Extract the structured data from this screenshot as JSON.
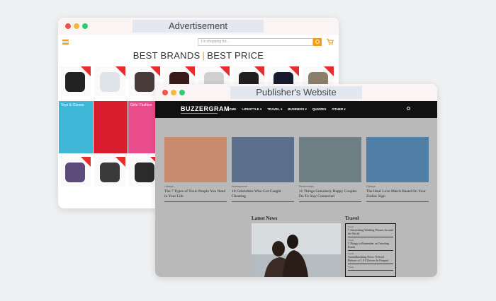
{
  "advertisement": {
    "window_title": "Advertisement",
    "search_placeholder": "I'm shopping for...",
    "headline_left": "BEST BRANDS",
    "headline_sep": "|",
    "headline_right": "BEST PRICE",
    "products": [
      {
        "color": "#222222"
      },
      {
        "color": "#dfe4ea"
      },
      {
        "color": "#4a3b3b"
      },
      {
        "color": "#3b1b1b"
      },
      {
        "color": "#d0d0d0"
      },
      {
        "color": "#1f1f1f"
      },
      {
        "color": "#1a1a2e"
      },
      {
        "color": "#8a7f6a"
      }
    ],
    "banners": [
      {
        "title": "Toys & Games",
        "color": "#3fb7d6"
      },
      {
        "title": "",
        "color": "#d81e2c"
      },
      {
        "title": "Girls' Fashion",
        "color": "#e94d8b"
      }
    ],
    "bottom_products": [
      {
        "color": "#5b4a7a"
      },
      {
        "color": "#3a3a3a"
      },
      {
        "color": "#2b2b2b"
      }
    ]
  },
  "publisher": {
    "window_title": "Publisher's Website",
    "logo": "BUZZERGRAM",
    "nav": [
      "HOME",
      "LIFESTYLE ▾",
      "TRAVEL ▾",
      "BUSINESS ▾",
      "QUIZZES",
      "OTHER ▾"
    ],
    "cards": [
      {
        "category": "Lifestyle",
        "title": "The 7 Types of Toxic People You Need in Your Life",
        "color": "#c98a6e"
      },
      {
        "category": "Entertainment",
        "title": "10 Celebrities Who Got Caught Cheating",
        "color": "#5b6f8c"
      },
      {
        "category": "Relationships",
        "title": "11 Things Genuinely Happy Couples Do To Stay Connected",
        "color": "#6e7f86"
      },
      {
        "category": "Lifestyle",
        "title": "The Ideal Love Match Based On Your Zodiac Sign",
        "color": "#4f7fa6"
      }
    ],
    "latest_news_label": "Latest News",
    "travel_label": "Travel",
    "travel_items": [
      {
        "category": "Travel",
        "title": "7 Astonishing Wedding Phrases Around the World"
      },
      {
        "category": "Travel",
        "title": "5 Things to Remember on Traveling Roads"
      },
      {
        "category": "Travel",
        "title": "Groundbreaking News: Official Release of 1.8.0 Drivers In Pompeii"
      },
      {
        "category": "Travel",
        "title": ""
      }
    ]
  }
}
